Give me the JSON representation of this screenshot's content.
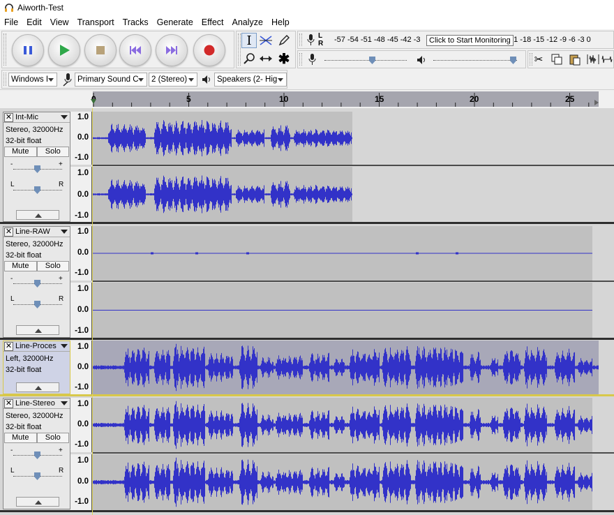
{
  "window": {
    "title": "Aiworth-Test"
  },
  "menu": [
    "File",
    "Edit",
    "View",
    "Transport",
    "Tracks",
    "Generate",
    "Effect",
    "Analyze",
    "Help"
  ],
  "transport": {
    "pause": "pause-icon",
    "play": "play-icon",
    "stop": "stop-icon",
    "skip_start": "skip-to-start-icon",
    "skip_end": "skip-to-end-icon",
    "record": "record-icon"
  },
  "meter": {
    "record_scale": "-57 -54 -51 -48 -45 -42 -3",
    "record_scale_tail": "21 -18 -15 -12  -9  -6  -3  0",
    "channel_l": "L",
    "channel_r": "R",
    "tooltip": "Click to Start Monitoring"
  },
  "device": {
    "host": "Windows I",
    "input": "Primary Sound C",
    "channels": "2 (Stereo)",
    "output": "Speakers (2- Hig"
  },
  "timeline": {
    "ticks": [
      "0",
      "5",
      "10",
      "15",
      "20",
      "25"
    ]
  },
  "tracks": [
    {
      "name": "Int-Mic",
      "info1": "Stereo, 32000Hz",
      "info2": "32-bit float",
      "mute": "Mute",
      "solo": "Solo",
      "gain_minus": "-",
      "gain_plus": "+",
      "pan_l": "L",
      "pan_r": "R"
    },
    {
      "name": "Line-RAW",
      "info1": "Stereo, 32000Hz",
      "info2": "32-bit float",
      "mute": "Mute",
      "solo": "Solo",
      "gain_minus": "-",
      "gain_plus": "+",
      "pan_l": "L",
      "pan_r": "R"
    },
    {
      "name": "Line-Proces",
      "info1": "Left, 32000Hz",
      "info2": "32-bit float"
    },
    {
      "name": "Line-Stereo",
      "info1": "Stereo, 32000Hz",
      "info2": "32-bit float",
      "mute": "Mute",
      "solo": "Solo",
      "gain_minus": "-",
      "gain_plus": "+",
      "pan_l": "L",
      "pan_r": "R"
    }
  ],
  "amp_labels": {
    "top": "1.0",
    "mid": "0.0",
    "bot": "-1.0"
  },
  "colors": {
    "waveform": "#3232c8",
    "clip": "#c0c0c0",
    "clip_selected": "#a8a8b8",
    "background": "#d6d6d6"
  }
}
